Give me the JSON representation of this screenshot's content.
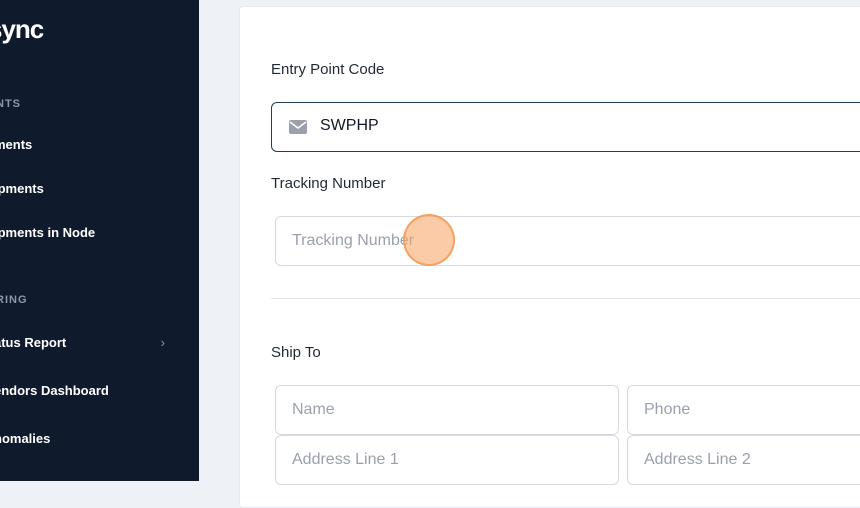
{
  "sidebar": {
    "logo": "sync",
    "sections": [
      {
        "label": "NTS",
        "items": [
          {
            "label": "ments"
          },
          {
            "label": "ipments"
          },
          {
            "label": "ipments in Node"
          }
        ]
      },
      {
        "label": "RING",
        "items": [
          {
            "label": "atus Report",
            "icon": "chevron-right-icon"
          },
          {
            "label": "endors Dashboard"
          },
          {
            "label": "nomalies"
          }
        ]
      }
    ]
  },
  "form": {
    "entry_point": {
      "label": "Entry Point Code",
      "value": "SWPHP",
      "icon": "envelope-icon"
    },
    "tracking": {
      "label": "Tracking Number",
      "placeholder": "Tracking Number"
    },
    "ship_to": {
      "label": "Ship To",
      "name_placeholder": "Name",
      "phone_placeholder": "Phone",
      "address1_placeholder": "Address Line 1",
      "address2_placeholder": "Address Line 2"
    }
  },
  "colors": {
    "sidebar_bg": "#0f1b2d",
    "focus_border": "#1f3d59",
    "click_indicator": "#f8a86c"
  }
}
